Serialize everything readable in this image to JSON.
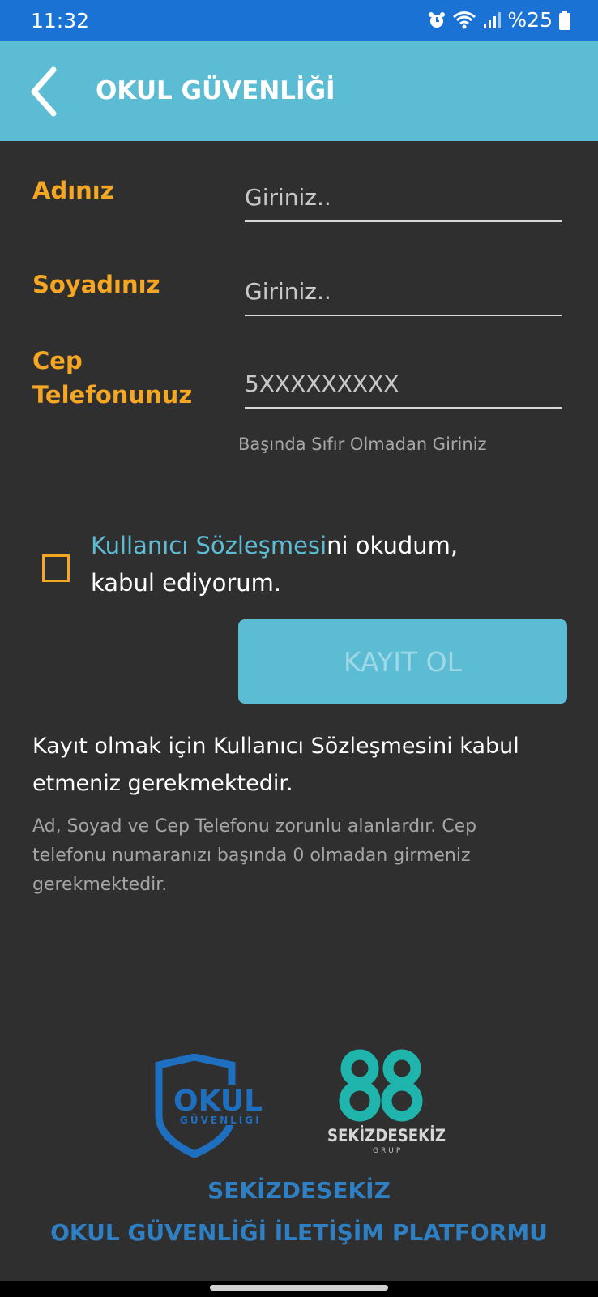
{
  "status_bar": {
    "time": "11:32",
    "battery": "%25",
    "icons": [
      "alarm-icon",
      "wifi-icon",
      "signal-icon",
      "battery-icon"
    ]
  },
  "app_bar": {
    "title": "OKUL GÜVENLİĞİ",
    "back_icon": "chevron-left-icon"
  },
  "form": {
    "first_name_label": "Adınız",
    "first_name_placeholder": "Giriniz..",
    "last_name_label": "Soyadınız",
    "last_name_placeholder": "Giriniz..",
    "phone_label_line1": "Cep",
    "phone_label_line2": "Telefonunuz",
    "phone_placeholder": "5XXXXXXXXX",
    "phone_hint": "Başında Sıfır Olmadan Giriniz"
  },
  "agreement": {
    "link_text": "Kullanıcı Sözleşmesi",
    "rest_line1": "ni okudum,",
    "line2": "kabul ediyorum.",
    "checked": false
  },
  "register_button": "KAYIT OL",
  "info": {
    "main": "Kayıt olmak için Kullanıcı Sözleşmesini kabul etmeniz gerekmektedir.",
    "secondary": "Ad, Soyad ve Cep Telefonu zorunlu alanlardır. Cep telefonu numaranızı başında 0 olmadan girmeniz gerekmektedir."
  },
  "logos": {
    "okul_top": "OKUL",
    "okul_bottom": "GÜVENLİĞİ",
    "sekiz_name": "SEKİZDESEKİZ",
    "sekiz_sub": "GRUP"
  },
  "footer": {
    "line1": "SEKİZDESEKİZ",
    "line2": "OKUL GÜVENLİĞİ İLETİŞİM PLATFORMU"
  },
  "colors": {
    "status_bar": "#1a72d4",
    "app_bar": "#5cbcd3",
    "background": "#2f2f2f",
    "label_orange": "#f5a623",
    "link_blue": "#5cbcd3",
    "footer_blue": "#2f7fc4",
    "logo_teal": "#1fb5ad"
  }
}
